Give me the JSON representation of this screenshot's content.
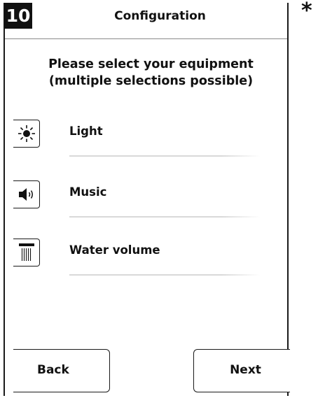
{
  "header": {
    "step_number": "10",
    "title": "Configuration"
  },
  "prompt": {
    "line1": "Please select your equipment",
    "line2": "(multiple selections possible)"
  },
  "equipment": [
    {
      "label": "Light",
      "icon": "sun-icon",
      "selected": false
    },
    {
      "label": "Music",
      "icon": "speaker-icon",
      "selected": false
    },
    {
      "label": "Water volume",
      "icon": "shower-head-icon",
      "selected": false
    }
  ],
  "buttons": {
    "back_label": "Back",
    "next_label": "Next"
  },
  "footnote_marker": "*"
}
